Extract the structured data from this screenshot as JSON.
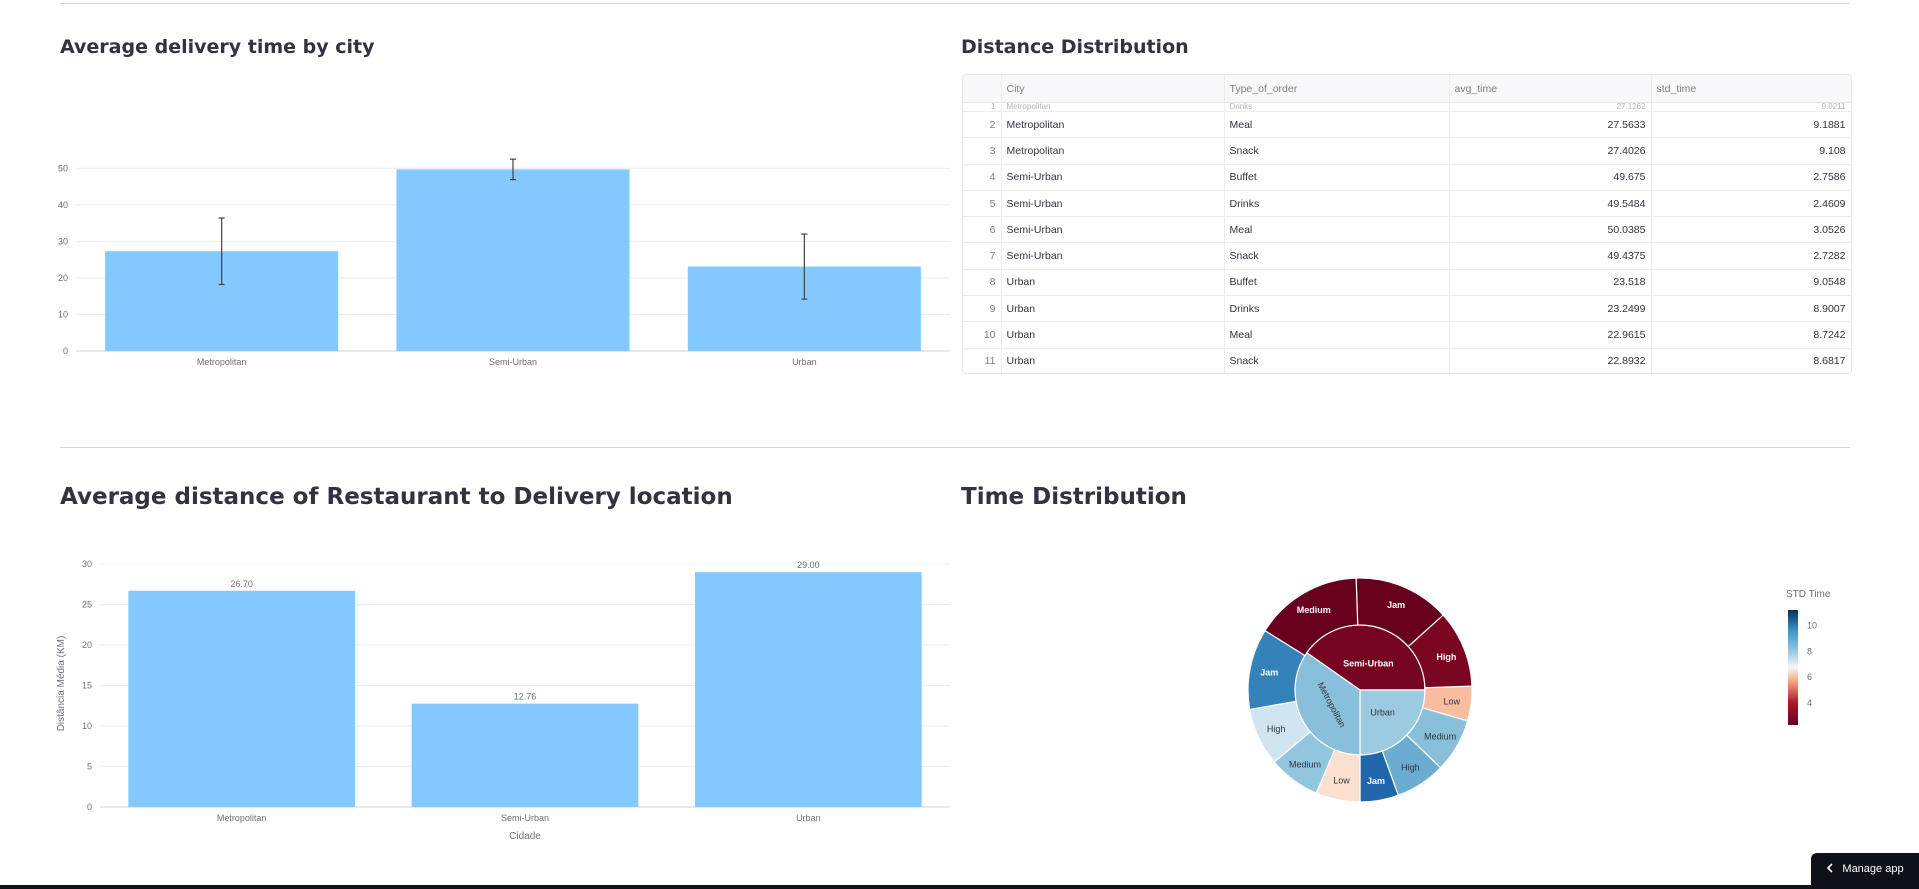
{
  "sections": {
    "avg_delivery_title": "Average delivery time by city",
    "distance_dist_title": "Distance Distribution",
    "avg_distance_title": "Average distance of Restaurant to Delivery location",
    "time_dist_title": "Time Distribution"
  },
  "table": {
    "columns": [
      "",
      "City",
      "Type_of_order",
      "avg_time",
      "std_time"
    ],
    "partial_row": [
      "1",
      "Metropolitan",
      "Drinks",
      "27.1262",
      "9.0211"
    ],
    "rows": [
      [
        "2",
        "Metropolitan",
        "Meal",
        "27.5633",
        "9.1881"
      ],
      [
        "3",
        "Metropolitan",
        "Snack",
        "27.4026",
        "9.108"
      ],
      [
        "4",
        "Semi-Urban",
        "Buffet",
        "49.675",
        "2.7586"
      ],
      [
        "5",
        "Semi-Urban",
        "Drinks",
        "49.5484",
        "2.4609"
      ],
      [
        "6",
        "Semi-Urban",
        "Meal",
        "50.0385",
        "3.0526"
      ],
      [
        "7",
        "Semi-Urban",
        "Snack",
        "49.4375",
        "2.7282"
      ],
      [
        "8",
        "Urban",
        "Buffet",
        "23.518",
        "9.0548"
      ],
      [
        "9",
        "Urban",
        "Drinks",
        "23.2499",
        "8.9007"
      ],
      [
        "10",
        "Urban",
        "Meal",
        "22.9615",
        "8.7242"
      ],
      [
        "11",
        "Urban",
        "Snack",
        "22.8932",
        "8.6817"
      ]
    ]
  },
  "chart_data": [
    {
      "type": "bar",
      "categories": [
        "Metropolitan",
        "Semi-Urban",
        "Urban"
      ],
      "values": [
        27.3,
        49.7,
        23.1
      ],
      "error": [
        9.1,
        2.8,
        8.9
      ],
      "ylim": [
        0,
        55
      ],
      "yticks": [
        0,
        10,
        20,
        30,
        40,
        50
      ],
      "title": "Average delivery time by city",
      "color": "#83c9ff",
      "grid": true
    },
    {
      "type": "bar",
      "categories": [
        "Metropolitan",
        "Semi-Urban",
        "Urban"
      ],
      "values": [
        26.7,
        12.76,
        29.0
      ],
      "labels": [
        "26.70",
        "12.76",
        "29.00"
      ],
      "ylim": [
        0,
        30.5
      ],
      "yticks": [
        0,
        5,
        10,
        15,
        20,
        25,
        30
      ],
      "xlabel": "Cidade",
      "ylabel": "Distância Média (KM)",
      "title": "Average distance of Restaurant to Delivery location",
      "color": "#83c9ff",
      "grid": true
    },
    {
      "type": "sunburst",
      "title": "Time Distribution",
      "colorbar": {
        "title": "STD Time",
        "ticks": [
          4,
          6,
          8,
          10
        ]
      },
      "inner": [
        {
          "label": "Semi-Urban",
          "value": 2.8
        },
        {
          "label": "Urban",
          "value": 8.9
        },
        {
          "label": "Metropolitan",
          "value": 9.1
        }
      ],
      "outer": [
        {
          "label": "Jam",
          "parent": "Semi-Urban",
          "value": 2.5
        },
        {
          "label": "High",
          "parent": "Semi-Urban",
          "value": 2.9
        },
        {
          "label": "Low",
          "parent": "Urban",
          "value": 6.8
        },
        {
          "label": "Medium",
          "parent": "Urban",
          "value": 9.1
        },
        {
          "label": "High",
          "parent": "Urban",
          "value": 9.4
        },
        {
          "label": "Jam",
          "parent": "Urban",
          "value": 10.8
        },
        {
          "label": "Low",
          "parent": "Metropolitan",
          "value": 7.3
        },
        {
          "label": "Medium",
          "parent": "Metropolitan",
          "value": 9.0
        },
        {
          "label": "High",
          "parent": "Metropolitan",
          "value": 8.4
        },
        {
          "label": "Jam",
          "parent": "Metropolitan",
          "value": 10.2
        },
        {
          "label": "Medium",
          "parent": "Semi-Urban",
          "value": 1.8
        }
      ]
    }
  ],
  "manage": {
    "label": "Manage app",
    "icon": "chevron-left-icon"
  }
}
